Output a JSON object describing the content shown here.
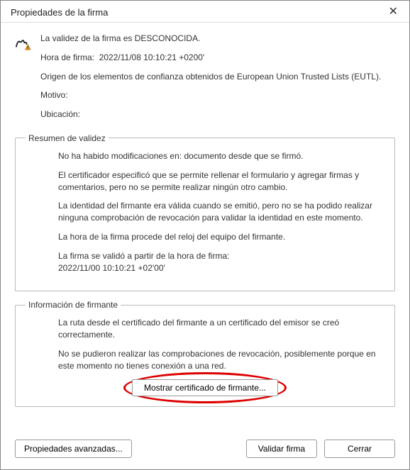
{
  "titlebar": {
    "title": "Propiedades de la firma"
  },
  "top": {
    "validity_line": "La validez de la firma es DESCONOCIDA.",
    "sign_time_label": "Hora de firma:",
    "sign_time_value": "2022/11/08 10:10:21 +0200'",
    "trust_origin": "Origen de los elementos de confianza obtenidos de European Union Trusted Lists (EUTL).",
    "reason_label": "Motivo:",
    "location_label": "Ubicación:"
  },
  "validity_summary": {
    "legend": "Resumen de validez",
    "no_mods": "No ha habido modificaciones en: documento desde que se firmó.",
    "certifier": "El certificador especificó que se permite rellenar el formulario y agregar firmas y comentarios, pero no se permite realizar ningún otro cambio.",
    "identity": "La identidad del firmante era válida cuando se emitió, pero no se ha podido realizar ninguna comprobación de revocación para validar la identidad en este momento.",
    "clock": "La hora de la firma procede del reloj del equipo del firmante.",
    "validated_from": "La firma se validó a partir de la hora de firma:",
    "validated_time": "2022/11/00 10:10:21 +02'00'"
  },
  "signer_info": {
    "legend": "Información de firmante",
    "chain": "La ruta desde el certificado del firmante a un certificado del emisor se creó correctamente.",
    "revocation": "No se pudieron realizar las comprobaciones de revocación, posiblemente porque en este momento no tienes conexión a una red.",
    "show_cert_button": "Mostrar certificado de firmante..."
  },
  "buttons": {
    "advanced": "Propiedades avanzadas...",
    "validate": "Validar firma",
    "close": "Cerrar"
  }
}
